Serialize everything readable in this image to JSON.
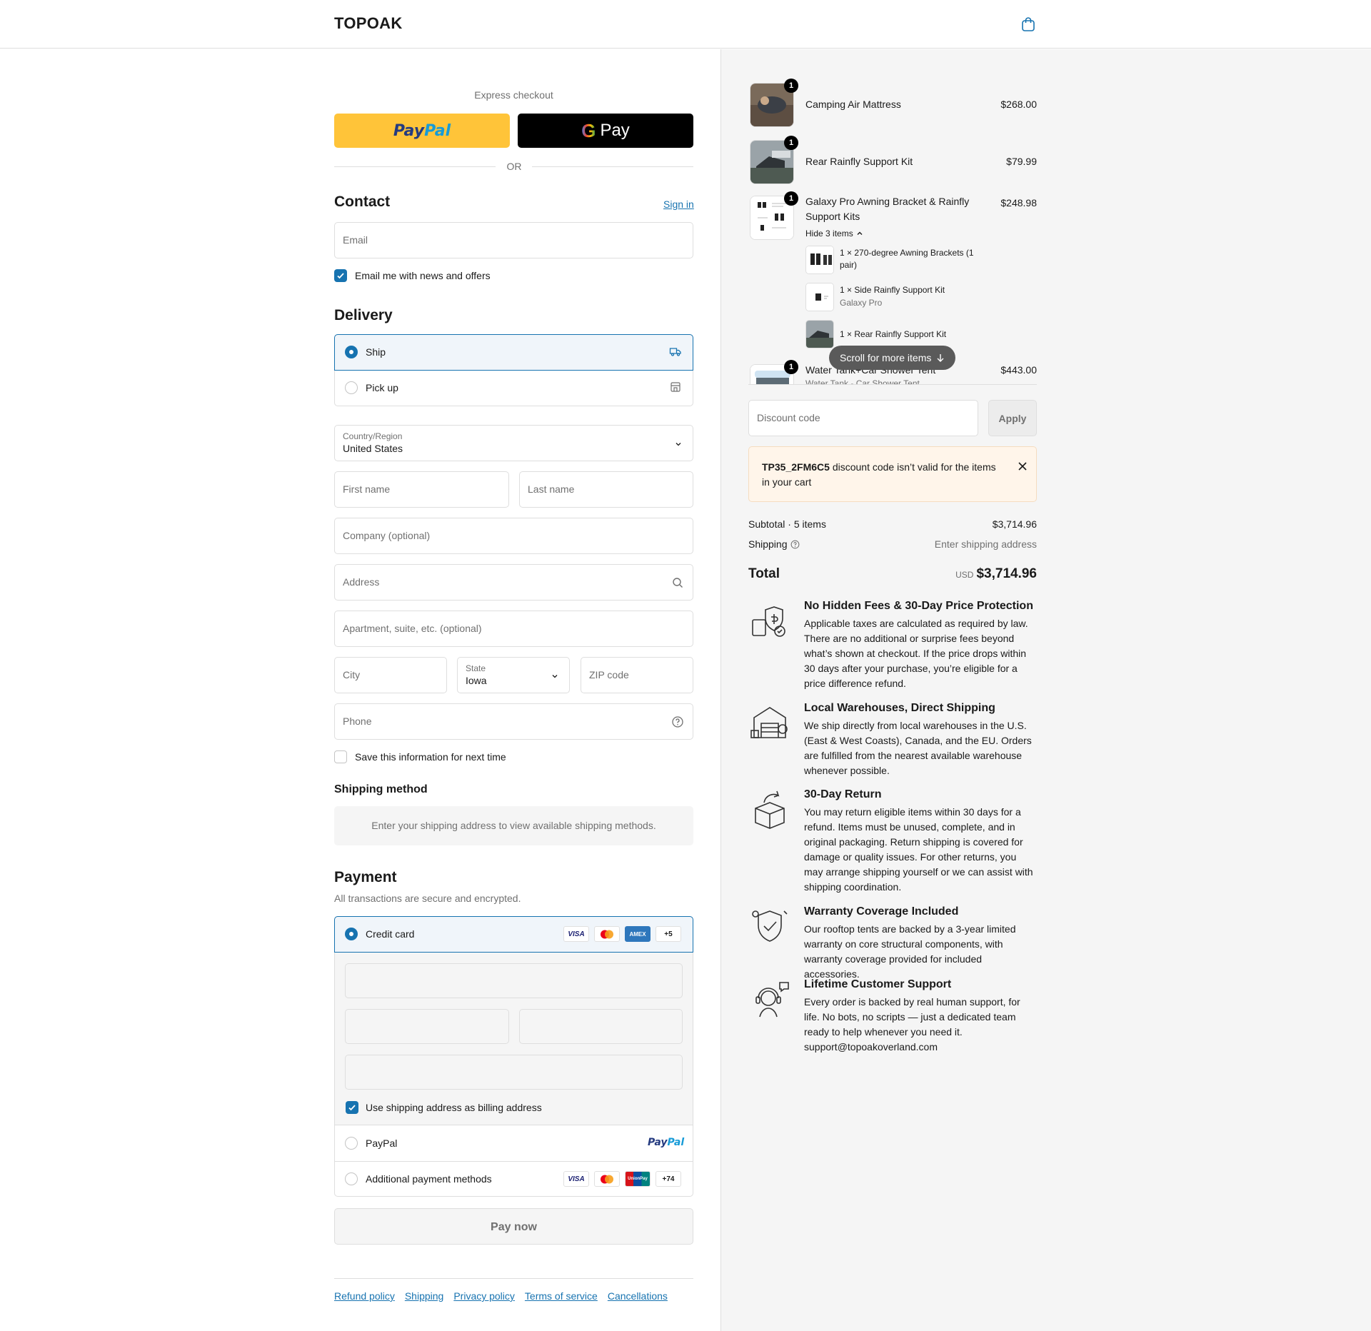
{
  "header": {
    "brand": "TOPOAK",
    "cart_icon": "shopping-bag-icon"
  },
  "express": {
    "label": "Express checkout",
    "paypal_label": "PayPal",
    "gpay_label": "Pay",
    "or": "OR"
  },
  "contact": {
    "title": "Contact",
    "sign_in": "Sign in",
    "email_placeholder": "Email",
    "news_label": "Email me with news and offers",
    "news_checked": true
  },
  "delivery": {
    "title": "Delivery",
    "options": [
      {
        "label": "Ship",
        "selected": true,
        "icon": "truck-icon"
      },
      {
        "label": "Pick up",
        "selected": false,
        "icon": "store-icon"
      }
    ],
    "country_label": "Country/Region",
    "country_value": "United States",
    "first_name": "First name",
    "last_name": "Last name",
    "company": "Company (optional)",
    "address": "Address",
    "apartment": "Apartment, suite, etc. (optional)",
    "city": "City",
    "state_label": "State",
    "state_value": "Iowa",
    "zip": "ZIP code",
    "phone": "Phone",
    "save_info": "Save this information for next time"
  },
  "shipping_method": {
    "title": "Shipping method",
    "message": "Enter your shipping address to view available shipping methods."
  },
  "payment": {
    "title": "Payment",
    "subtitle": "All transactions are secure and encrypted.",
    "credit_card": "Credit card",
    "cc_more": "+5",
    "billing_label": "Use shipping address as billing address",
    "paypal": "PayPal",
    "paypal_logo": "PayPal",
    "additional": "Additional payment methods",
    "additional_more": "+74",
    "card_logos": [
      "VISA",
      "Mastercard",
      "AMEX"
    ],
    "additional_logos": [
      "VISA",
      "Mastercard",
      "UnionPay"
    ]
  },
  "pay_now": "Pay now",
  "footer_links": [
    "Refund policy",
    "Shipping",
    "Privacy policy",
    "Terms of service",
    "Cancellations"
  ],
  "cart": {
    "items": [
      {
        "name": "Camping Air Mattress",
        "price": "$268.00",
        "qty": "1"
      },
      {
        "name": "Rear Rainfly Support Kit",
        "price": "$79.99",
        "qty": "1"
      },
      {
        "name": "Galaxy Pro Awning Bracket & Rainfly Support Kits",
        "price": "$248.98",
        "qty": "1",
        "toggle": "Hide 3 items"
      },
      {
        "name": "Water Tank+Car Shower Tent",
        "price": "$443.00",
        "qty": "1",
        "variant": "Water Tank - Car Shower Tent"
      }
    ],
    "bundle": [
      {
        "name": "1 × 270-degree Awning Brackets (1 pair)",
        "variant": ""
      },
      {
        "name": "1 × Side Rainfly Support Kit",
        "variant": "Galaxy Pro"
      },
      {
        "name": "1 × Rear Rainfly Support Kit",
        "variant": ""
      }
    ],
    "scroll_hint": "Scroll for more items"
  },
  "discount": {
    "placeholder": "Discount code",
    "apply": "Apply",
    "code": "TP35_2FM6C5",
    "error": " discount code isn’t valid for the items in your cart"
  },
  "summary": {
    "subtotal_label": "Subtotal · 5 items",
    "subtotal": "$3,714.96",
    "shipping_label": "Shipping",
    "shipping_value": "Enter shipping address",
    "total_label": "Total",
    "currency": "USD",
    "total": "$3,714.96"
  },
  "features": [
    {
      "title": "No Hidden Fees & 30-Day Price Protection",
      "body": "Applicable taxes are calculated as required by law. There are no additional or surprise fees beyond what’s shown at checkout. If the price drops within 30 days after your purchase, you’re eligible for a price difference refund.",
      "icon": "shield-price-icon"
    },
    {
      "title": "Local Warehouses, Direct Shipping",
      "body": "We ship directly from local warehouses in the U.S. (East & West Coasts), Canada, and the EU. Orders are fulfilled from the nearest available warehouse whenever possible.",
      "icon": "warehouse-icon"
    },
    {
      "title": "30-Day Return",
      "body": "You may return eligible items within 30 days for a refund. Items must be unused, complete, and in original packaging. Return shipping is covered for damage or quality issues. For other returns, you may arrange shipping yourself or we can assist with shipping coordination.",
      "icon": "return-box-icon"
    },
    {
      "title": "Warranty Coverage Included",
      "body": "Our rooftop tents are backed by a 3-year limited warranty on core structural components, with warranty coverage provided for included accessories.",
      "icon": "warranty-shield-icon"
    },
    {
      "title": "Lifetime Customer Support",
      "body": "Every order is backed by real human support, for life. No bots, no scripts — just a dedicated team ready to help whenever you need it.",
      "email": "support@topoakoverland.com",
      "icon": "support-agent-icon"
    }
  ]
}
